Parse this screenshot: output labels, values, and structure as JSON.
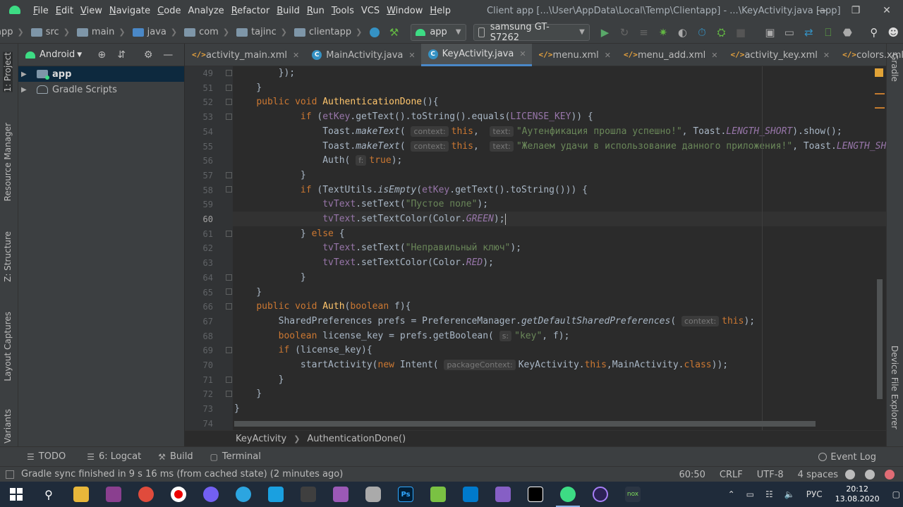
{
  "menubar": {
    "items": [
      {
        "label": "File",
        "u": "F",
        "rest": "ile"
      },
      {
        "label": "Edit",
        "u": "E",
        "rest": "dit"
      },
      {
        "label": "View",
        "u": "V",
        "rest": "iew"
      },
      {
        "label": "Navigate",
        "u": "N",
        "rest": "avigate"
      },
      {
        "label": "Code",
        "u": "C",
        "rest": "ode"
      },
      {
        "label": "Analyze",
        "u": "",
        "rest": "Analyze"
      },
      {
        "label": "Refactor",
        "u": "R",
        "rest": "efactor"
      },
      {
        "label": "Build",
        "u": "B",
        "rest": "uild"
      },
      {
        "label": "Run",
        "u": "R",
        "rest": "un"
      },
      {
        "label": "Tools",
        "u": "T",
        "rest": "ools"
      },
      {
        "label": "VCS",
        "u": "",
        "rest": "VCS"
      },
      {
        "label": "Window",
        "u": "W",
        "rest": "indow"
      },
      {
        "label": "Help",
        "u": "H",
        "rest": "elp"
      }
    ],
    "window_title": "Client app [...\\User\\AppData\\Local\\Temp\\Clientapp] - ...\\KeyActivity.java [app]"
  },
  "toolbar": {
    "crumbs": [
      "app",
      "src",
      "main",
      "java",
      "com",
      "tajinc",
      "clientapp"
    ],
    "run_config": "app",
    "device": "samsung GT-S7262"
  },
  "left_tools": {
    "project": "1: Project",
    "resource_manager": "Resource Manager",
    "structure": "Z: Structure",
    "layout_captures": "Layout Captures",
    "build_variants": "Build Variants"
  },
  "right_tools": {
    "gradle": "Gradle",
    "device_file_explorer": "Device File Explorer"
  },
  "project_panel": {
    "view_mode": "Android",
    "tree": [
      {
        "label": "app",
        "selected": true
      },
      {
        "label": "Gradle Scripts",
        "selected": false
      }
    ]
  },
  "tabs": [
    {
      "label": "activity_main.xml",
      "type": "xml",
      "active": false
    },
    {
      "label": "MainActivity.java",
      "type": "java",
      "active": false
    },
    {
      "label": "KeyActivity.java",
      "type": "java",
      "active": true
    },
    {
      "label": "menu.xml",
      "type": "xml",
      "active": false
    },
    {
      "label": "menu_add.xml",
      "type": "xml",
      "active": false
    },
    {
      "label": "activity_key.xml",
      "type": "xml",
      "active": false
    },
    {
      "label": "colors.xml",
      "type": "xml",
      "active": false
    }
  ],
  "editor": {
    "line_numbers": [
      "49",
      "51",
      "52",
      "53",
      "54",
      "55",
      "56",
      "57",
      "58",
      "59",
      "60",
      "61",
      "62",
      "63",
      "64",
      "65",
      "66",
      "67",
      "68",
      "69",
      "70",
      "71",
      "72",
      "73",
      "74"
    ],
    "current_line": "60",
    "hints": {
      "context": "context:",
      "text": "text:",
      "f": "f:",
      "s": "s:",
      "packageContext": "packageContext:"
    },
    "strings": {
      "auth_ok": "\"Аутенфикация прошла успешно!\"",
      "wish": "\"Желаем удачи в использование данного приложения!\"",
      "empty_field": "\"Пустое поле\"",
      "wrong_key": "\"Неправильный ключ\"",
      "key": "\"key\""
    }
  },
  "editor_crumbs": [
    "KeyActivity",
    "AuthenticationDone()"
  ],
  "bottom_tools": {
    "todo": "TODO",
    "logcat": "6: Logcat",
    "build": "Build",
    "terminal": "Terminal",
    "event_log": "Event Log"
  },
  "status": {
    "message": "Gradle sync finished in 9 s 16 ms (from cached state) (2 minutes ago)",
    "position": "60:50",
    "line_sep": "CRLF",
    "encoding": "UTF-8",
    "indent": "4 spaces"
  },
  "taskbar": {
    "lang": "РУС",
    "time": "20:12",
    "date": "13.08.2020",
    "nox": "nox"
  }
}
